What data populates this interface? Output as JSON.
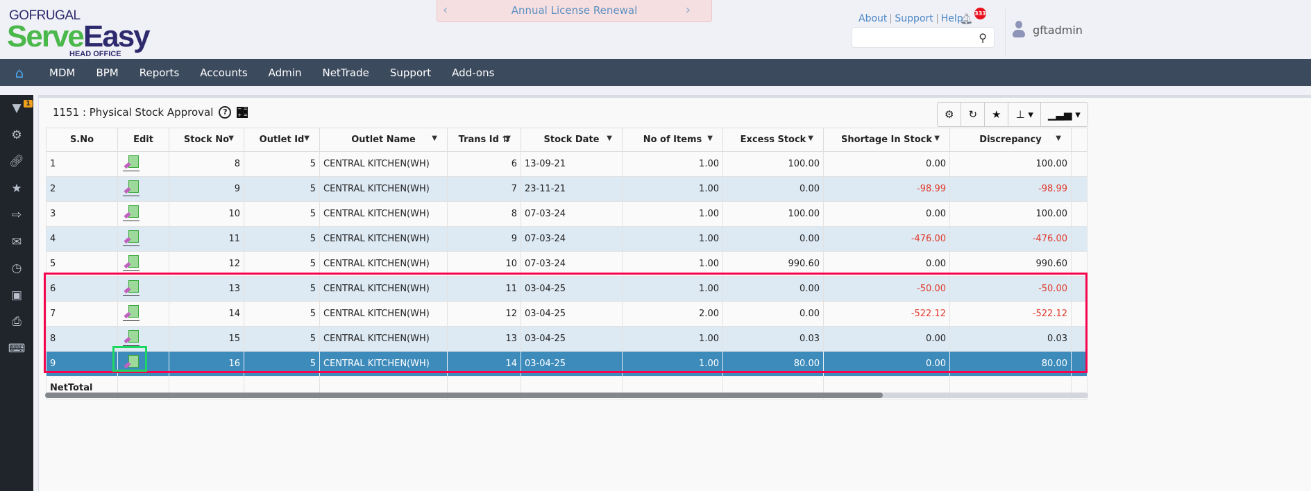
{
  "brand": {
    "company": "GOFRUGAL",
    "product_part1": "Serve",
    "product_part2": "Easy",
    "edition": "HEAD OFFICE"
  },
  "banner": {
    "text": "Annual License Renewal",
    "prev": "‹",
    "next": "›"
  },
  "toplinks": [
    "About",
    "Support",
    "Help"
  ],
  "notifications": {
    "count": "333"
  },
  "search": {
    "placeholder": "",
    "value": ""
  },
  "user": {
    "name": "gftadmin"
  },
  "nav": {
    "items": [
      "MDM",
      "BPM",
      "Reports",
      "Accounts",
      "Admin",
      "NetTrade",
      "Support",
      "Add-ons"
    ]
  },
  "sidebar": {
    "filter_badge": "1"
  },
  "page": {
    "title": "1151 : Physical Stock Approval"
  },
  "table": {
    "columns": [
      "S.No",
      "Edit",
      "Stock No",
      "Outlet Id",
      "Outlet Name",
      "Trans Id",
      "Stock Date",
      "No of Items",
      "Excess Stock",
      "Shortage In Stock",
      "Discrepancy"
    ],
    "trans_sort_icon": "⇅",
    "rows": [
      {
        "sno": "1",
        "stock_no": "8",
        "outlet_id": "5",
        "outlet_name": "CENTRAL KITCHEN(WH)",
        "trans_id": "6",
        "date": "13-09-21",
        "items": "1.00",
        "excess": "100.00",
        "shortage": "0.00",
        "discrepancy": "100.00"
      },
      {
        "sno": "2",
        "stock_no": "9",
        "outlet_id": "5",
        "outlet_name": "CENTRAL KITCHEN(WH)",
        "trans_id": "7",
        "date": "23-11-21",
        "items": "1.00",
        "excess": "0.00",
        "shortage": "-98.99",
        "discrepancy": "-98.99"
      },
      {
        "sno": "3",
        "stock_no": "10",
        "outlet_id": "5",
        "outlet_name": "CENTRAL KITCHEN(WH)",
        "trans_id": "8",
        "date": "07-03-24",
        "items": "1.00",
        "excess": "100.00",
        "shortage": "0.00",
        "discrepancy": "100.00"
      },
      {
        "sno": "4",
        "stock_no": "11",
        "outlet_id": "5",
        "outlet_name": "CENTRAL KITCHEN(WH)",
        "trans_id": "9",
        "date": "07-03-24",
        "items": "1.00",
        "excess": "0.00",
        "shortage": "-476.00",
        "discrepancy": "-476.00"
      },
      {
        "sno": "5",
        "stock_no": "12",
        "outlet_id": "5",
        "outlet_name": "CENTRAL KITCHEN(WH)",
        "trans_id": "10",
        "date": "07-03-24",
        "items": "1.00",
        "excess": "990.60",
        "shortage": "0.00",
        "discrepancy": "990.60"
      },
      {
        "sno": "6",
        "stock_no": "13",
        "outlet_id": "5",
        "outlet_name": "CENTRAL KITCHEN(WH)",
        "trans_id": "11",
        "date": "03-04-25",
        "items": "1.00",
        "excess": "0.00",
        "shortage": "-50.00",
        "discrepancy": "-50.00"
      },
      {
        "sno": "7",
        "stock_no": "14",
        "outlet_id": "5",
        "outlet_name": "CENTRAL KITCHEN(WH)",
        "trans_id": "12",
        "date": "03-04-25",
        "items": "2.00",
        "excess": "0.00",
        "shortage": "-522.12",
        "discrepancy": "-522.12"
      },
      {
        "sno": "8",
        "stock_no": "15",
        "outlet_id": "5",
        "outlet_name": "CENTRAL KITCHEN(WH)",
        "trans_id": "13",
        "date": "03-04-25",
        "items": "1.00",
        "excess": "0.03",
        "shortage": "0.00",
        "discrepancy": "0.03"
      },
      {
        "sno": "9",
        "stock_no": "16",
        "outlet_id": "5",
        "outlet_name": "CENTRAL KITCHEN(WH)",
        "trans_id": "14",
        "date": "03-04-25",
        "items": "1.00",
        "excess": "80.00",
        "shortage": "0.00",
        "discrepancy": "80.00"
      }
    ],
    "selected_row": "9",
    "footer_label": "NetTotal"
  },
  "colors": {
    "nav": "#3c4a5e",
    "selected_row": "#3d8bbb",
    "negative": "#e03a2a",
    "highlight_red": "#f5054f",
    "highlight_green": "#1ed760"
  }
}
